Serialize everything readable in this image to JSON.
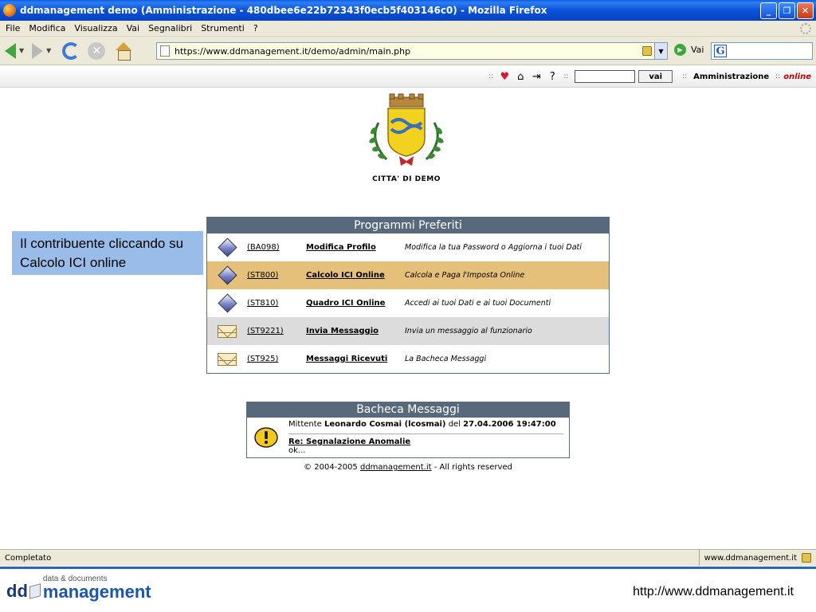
{
  "window": {
    "title": "ddmanagement demo (Amministrazione - 480dbee6e22b72343f0ecb5f403146c0) - Mozilla Firefox",
    "controls": [
      "minimize-icon",
      "restore-icon",
      "close-icon"
    ]
  },
  "menu": {
    "items": [
      "File",
      "Modifica",
      "Visualizza",
      "Vai",
      "Segnalibri",
      "Strumenti",
      "?"
    ]
  },
  "navbar": {
    "url": "https://www.ddmanagement.it/demo/admin/main.php",
    "go_label": "Vai",
    "search_value": ""
  },
  "sitebar": {
    "sep": "::",
    "search_value": "",
    "search_button": "vai",
    "section": "Amministrazione",
    "status": "online",
    "icons": [
      "heart-icon",
      "home-icon",
      "exit-icon",
      "help-icon"
    ]
  },
  "crest": {
    "caption": "CITTA' DI DEMO"
  },
  "callout": {
    "text": "Il contribuente cliccando su Calcolo ICI online"
  },
  "programmi": {
    "title": "Programmi Preferiti",
    "rows": [
      {
        "icon": "diamond-icon",
        "code": "(BA098)",
        "name": "Modifica Profilo",
        "desc": "Modifica la tua Password o Aggiorna i tuoi Dati"
      },
      {
        "icon": "diamond-icon",
        "code": "(ST800)",
        "name": "Calcolo ICI Online",
        "desc": "Calcola e Paga l'Imposta Online"
      },
      {
        "icon": "diamond-icon",
        "code": "(ST810)",
        "name": "Quadro ICI Online",
        "desc": "Accedi ai tuoi Dati e ai tuoi Documenti"
      },
      {
        "icon": "envelope-icon",
        "code": "(ST9221)",
        "name": "Invia Messaggio",
        "desc": "Invia un messaggio al funzionario"
      },
      {
        "icon": "envelope-icon",
        "code": "(ST925)",
        "name": "Messaggi Ricevuti",
        "desc": "La Bacheca Messaggi"
      }
    ],
    "highlight_color": "#e5c07a"
  },
  "bacheca": {
    "title": "Bacheca Messaggi",
    "mittente_label": "Mittente",
    "sender": "Leonardo Cosmai (lcosmai)",
    "del_label": "del",
    "datetime": "27.04.2006 19:47:00",
    "subject": "Re: Segnalazione Anomalie",
    "body": "ok..."
  },
  "copyright": {
    "prefix": "© 2004-2005",
    "link": "ddmanagement.it",
    "suffix": "- All rights reserved"
  },
  "statusbar": {
    "status": "Completato",
    "domain": "www.ddmanagement.it"
  },
  "footer": {
    "logo_dd": "dd",
    "logo_tagline": "data & documents",
    "logo_name": "management",
    "url": "http://www.ddmanagement.it"
  },
  "colors": {
    "header_bar": "#58697b",
    "callout_bg": "#99bce8",
    "online": "#c00000"
  }
}
